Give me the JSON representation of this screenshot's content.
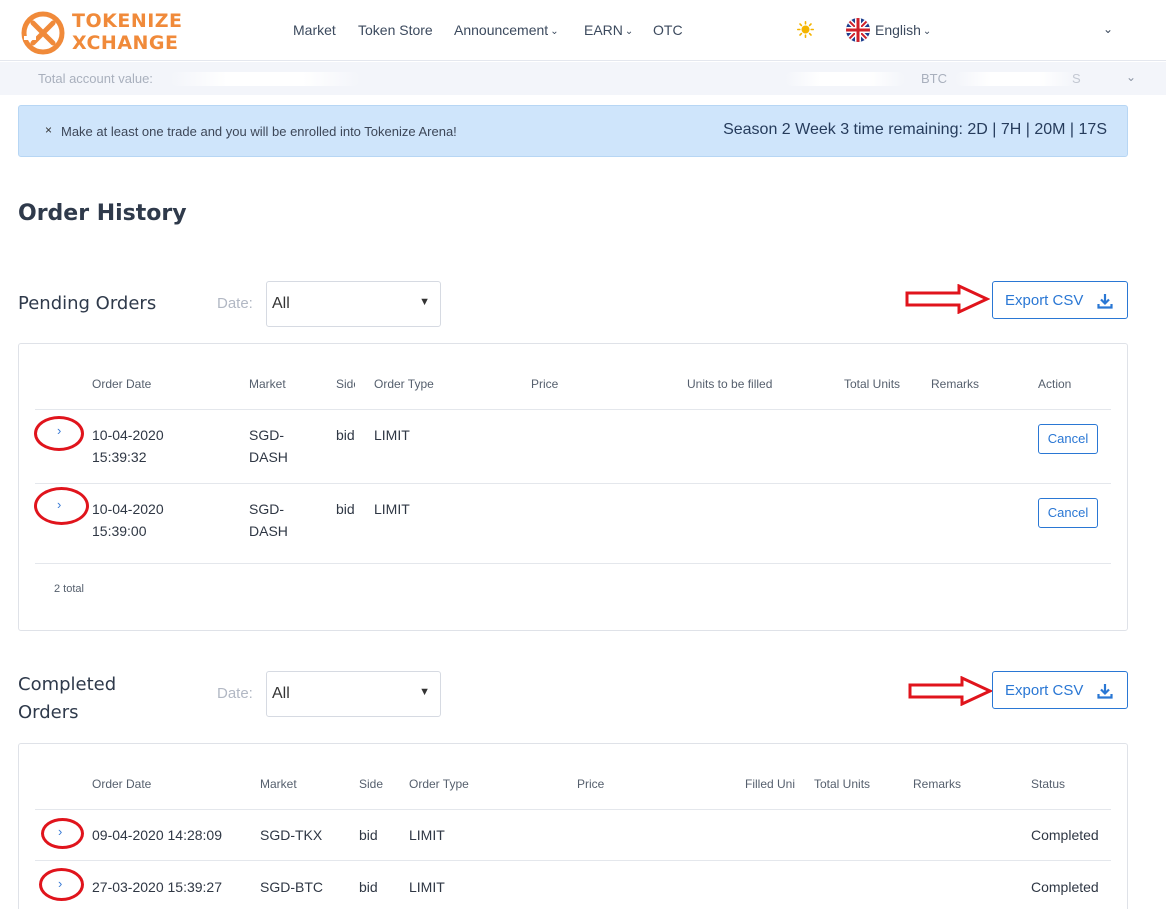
{
  "brand": {
    "line1": "TOKENIZE",
    "line2": "XCHANGE",
    "color": "#f08a3a"
  },
  "nav": {
    "items": [
      "Market",
      "Token Store",
      "Announcement",
      "EARN",
      "OTC"
    ],
    "language": "English",
    "theme_icon": "sun-icon",
    "flag_icon": "uk-flag-icon"
  },
  "account": {
    "total_label": "Total account value:",
    "btc_label": "BTC",
    "currency_suffix": "S"
  },
  "banner": {
    "close_glyph": "×",
    "message": "Make at least one trade and you will be enrolled into Tokenize Arena!",
    "timer": "Season 2 Week 3 time remaining: 2D | 7H | 20M | 17S"
  },
  "page": {
    "title": "Order History"
  },
  "pending": {
    "title": "Pending Orders",
    "date_label": "Date:",
    "date_value": "All",
    "export_label": "Export CSV",
    "columns": [
      "Order Date",
      "Market",
      "Side",
      "Order Type",
      "Price",
      "Units to be filled",
      "Total Units",
      "Remarks",
      "Action"
    ],
    "rows": [
      {
        "date": "10-04-2020",
        "time": "15:39:32",
        "market1": "SGD-",
        "market2": "DASH",
        "side": "bid",
        "type": "LIMIT",
        "action": "Cancel"
      },
      {
        "date": "10-04-2020",
        "time": "15:39:00",
        "market1": "SGD-",
        "market2": "DASH",
        "side": "bid",
        "type": "LIMIT",
        "action": "Cancel"
      }
    ],
    "total": "2 total"
  },
  "completed": {
    "title_line1": "Completed",
    "title_line2": "Orders",
    "date_label": "Date:",
    "date_value": "All",
    "export_label": "Export CSV",
    "columns": [
      "Order Date",
      "Market",
      "Side",
      "Order Type",
      "Price",
      "Filled Units",
      "Total Units",
      "Remarks",
      "Status"
    ],
    "rows": [
      {
        "datetime": "09-04-2020 14:28:09",
        "market": "SGD-TKX",
        "side": "bid",
        "type": "LIMIT",
        "status": "Completed"
      },
      {
        "datetime": "27-03-2020 15:39:27",
        "market": "SGD-BTC",
        "side": "bid",
        "type": "LIMIT",
        "status": "Completed"
      }
    ]
  },
  "colors": {
    "accent": "#2a77d4",
    "annotation": "#e0141c",
    "banner_bg": "#cfe5fb"
  },
  "icons": {
    "expand": "›",
    "caret": "▼",
    "chevron": "⌄"
  }
}
